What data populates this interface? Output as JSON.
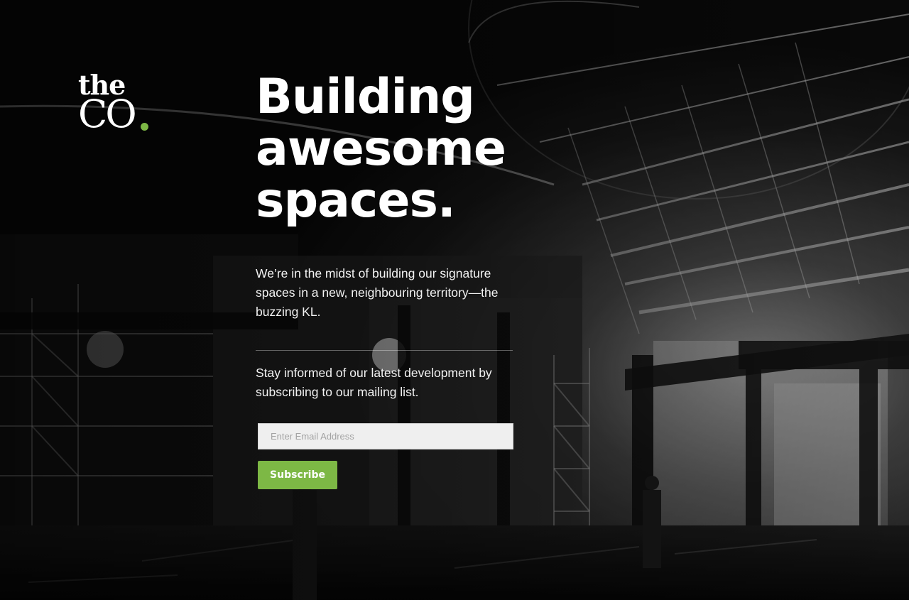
{
  "brand": {
    "logo_line1": "the",
    "logo_line2": "CO",
    "accent_color": "#7db845"
  },
  "hero": {
    "headline_lines": [
      "Building",
      "awesome",
      "spaces."
    ],
    "intro": "We’re in the midst of building our signature spaces in a new, neighbouring territory—the buzzing KL."
  },
  "newsletter": {
    "description": "Stay informed of our latest development by subscribing to our mailing list.",
    "email_placeholder": "Enter Email Address",
    "email_value": "",
    "subscribe_label": "Subscribe",
    "button_color": "#7db845",
    "input_background": "#efefef"
  }
}
